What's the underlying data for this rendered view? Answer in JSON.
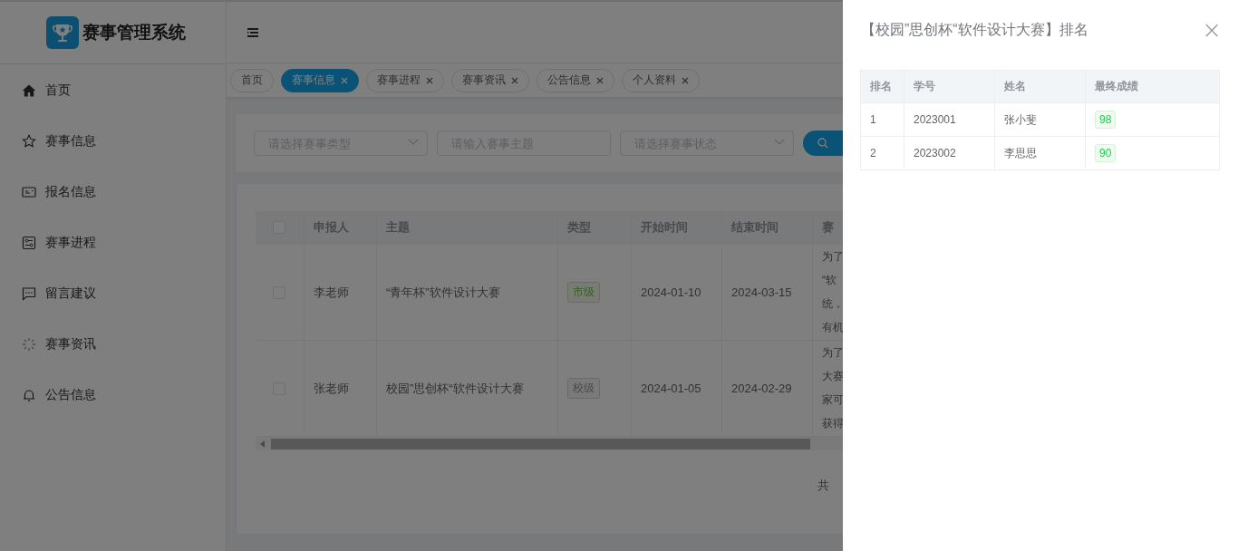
{
  "logo": {
    "title": "赛事管理系统"
  },
  "sidebar": {
    "items": [
      {
        "label": "首页",
        "kind": "home"
      },
      {
        "label": "赛事信息",
        "kind": "star"
      },
      {
        "label": "报名信息",
        "kind": "card"
      },
      {
        "label": "赛事进程",
        "kind": "sliders"
      },
      {
        "label": "留言建议",
        "kind": "chat"
      },
      {
        "label": "赛事资讯",
        "kind": "spinner"
      },
      {
        "label": "公告信息",
        "kind": "bell"
      }
    ]
  },
  "tabs": [
    {
      "label": "首页",
      "selected": false,
      "closable": false
    },
    {
      "label": "赛事信息",
      "selected": true,
      "closable": true
    },
    {
      "label": "赛事进程",
      "selected": false,
      "closable": true
    },
    {
      "label": "赛事资讯",
      "selected": false,
      "closable": true
    },
    {
      "label": "公告信息",
      "selected": false,
      "closable": true
    },
    {
      "label": "个人资料",
      "selected": false,
      "closable": true
    }
  ],
  "filters": [
    {
      "kind": "select",
      "placeholder": "请选择赛事类型"
    },
    {
      "kind": "input",
      "placeholder": "请输入赛事主题"
    },
    {
      "kind": "select",
      "placeholder": "请选择赛事状态"
    }
  ],
  "table": {
    "all_checked": false,
    "columns": [
      "申报人",
      "主题",
      "类型",
      "开始时间",
      "结束时间",
      "赛"
    ],
    "rows": [
      {
        "checked": false,
        "applicant": "李老师",
        "title": "“青年杯”软件设计大赛",
        "type": {
          "label": "市级",
          "kind": "success"
        },
        "start": "2024-01-10",
        "end": "2024-03-15",
        "description": [
          "为了",
          "“软",
          "统，",
          "有机"
        ]
      },
      {
        "checked": false,
        "applicant": "张老师",
        "title": "校园”思创杯“软件设计大赛",
        "type": {
          "label": "校级",
          "kind": "info"
        },
        "start": "2024-01-05",
        "end": "2024-02-29",
        "description": [
          "为了",
          "大赛",
          "家可",
          "获得"
        ]
      }
    ]
  },
  "pagination": {
    "total_text": "共"
  },
  "drawer": {
    "title": "【校园”思创杯“软件设计大赛】排名",
    "close": "×",
    "columns": [
      "排名",
      "学号",
      "姓名",
      "最终成绩"
    ],
    "rows": [
      {
        "rank": "1",
        "student_id": "2023001",
        "name": "张小斐",
        "score": "98"
      },
      {
        "rank": "2",
        "student_id": "2023002",
        "name": "李思思",
        "score": "90"
      }
    ]
  }
}
